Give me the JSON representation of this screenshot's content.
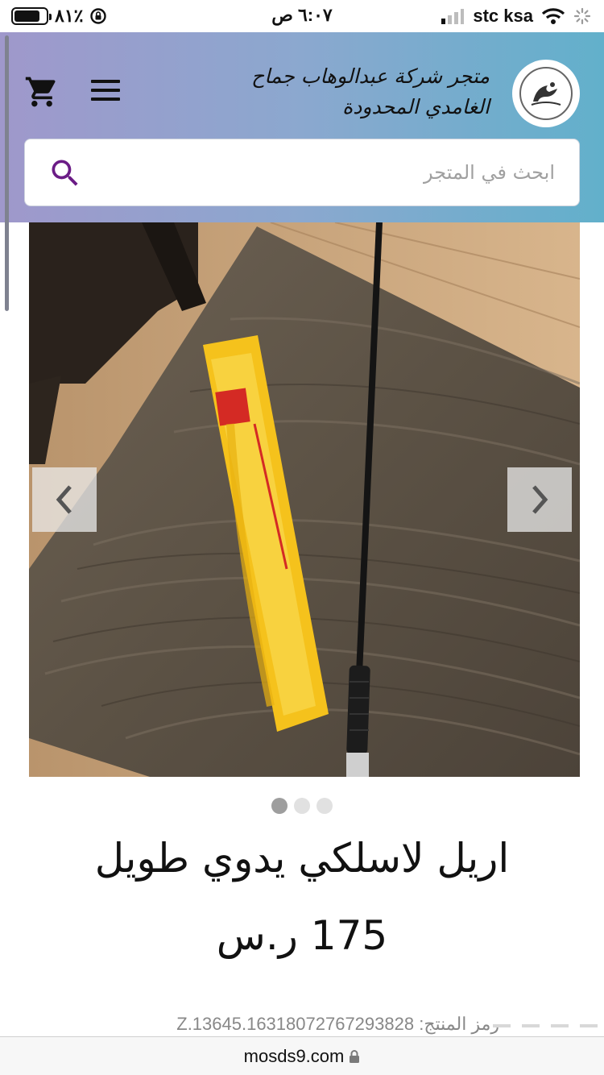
{
  "status_bar": {
    "battery_percent": "٨١٪",
    "battery_level": 0.81,
    "time": "٦:٠٧ ص",
    "carrier": "stc ksa"
  },
  "header": {
    "store_name": "متجر شركة عبدالوهاب جماح الغامدي المحدودة",
    "icons": [
      "cart-icon",
      "menu-icon",
      "store-logo"
    ],
    "gradient_colors": [
      "#9f98cb",
      "#8ba8cf",
      "#62b0cb"
    ]
  },
  "search": {
    "placeholder": "ابحث في المتجر",
    "value": "",
    "icon_color": "#6b1c86"
  },
  "carousel": {
    "image_count": 3,
    "active_index": 0
  },
  "product": {
    "title": "اريل لاسلكي يدوي طويل",
    "price": "175 ر.س",
    "code": "رمز المنتج: Z.13645.16318072767293828"
  },
  "browser": {
    "url": "mosds9.com"
  }
}
